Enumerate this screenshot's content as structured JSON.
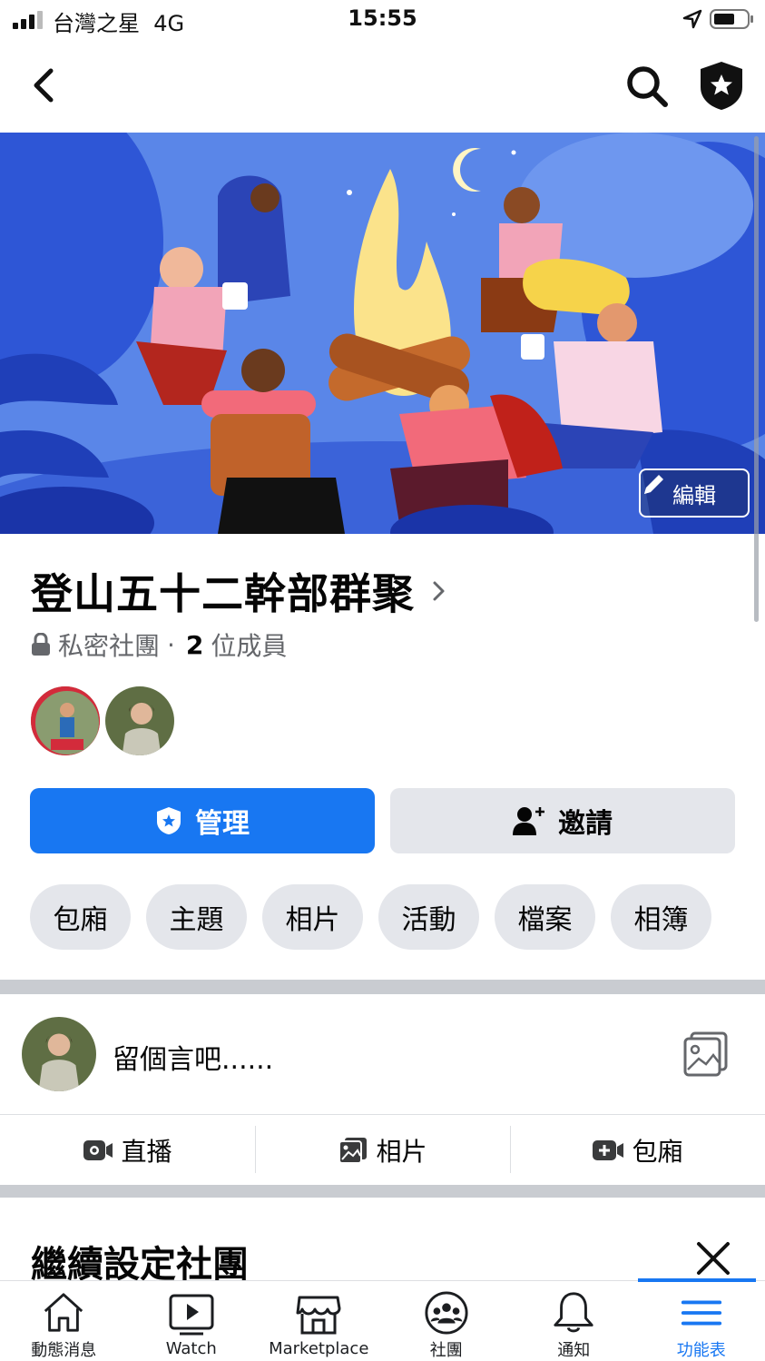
{
  "status_bar": {
    "carrier": "台灣之星",
    "network": "4G",
    "time": "15:55"
  },
  "cover": {
    "edit_label": "編輯"
  },
  "group": {
    "name": "登山五十二幹部群聚",
    "privacy": "私密社團",
    "separator": "·",
    "member_count": "2",
    "member_suffix": "位成員"
  },
  "buttons": {
    "manage": "管理",
    "invite": "邀請"
  },
  "chips": [
    "包廂",
    "主題",
    "相片",
    "活動",
    "檔案",
    "相簿"
  ],
  "composer": {
    "placeholder": "留個言吧......"
  },
  "actions": {
    "live": "直播",
    "photo": "相片",
    "room": "包廂"
  },
  "setup": {
    "title": "繼續設定社團"
  },
  "tabs": [
    {
      "label": "動態消息",
      "icon": "home-icon"
    },
    {
      "label": "Watch",
      "icon": "watch-icon"
    },
    {
      "label": "Marketplace",
      "icon": "marketplace-icon"
    },
    {
      "label": "社團",
      "icon": "groups-icon"
    },
    {
      "label": "通知",
      "icon": "bell-icon"
    },
    {
      "label": "功能表",
      "icon": "menu-icon",
      "active": true
    }
  ],
  "colors": {
    "brand": "#1877f2",
    "chip_bg": "#e4e6eb",
    "meta_text": "#65676b"
  }
}
